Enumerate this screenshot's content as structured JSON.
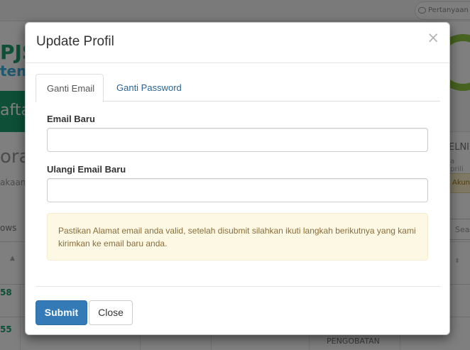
{
  "background": {
    "question_label": "Pertanyaan",
    "logo_text": "PJS",
    "logo_sub": "ten",
    "green_nav_text": "afta",
    "heading_partial": "ora",
    "sub_partial": "akaan",
    "right_text": "ELNI",
    "right_sub": "a prili",
    "badge_partial": "Akun",
    "rows_label": "ows",
    "search_partial": "Sea",
    "row_num_1": "58",
    "row_num_2": "55",
    "cell_text": "PENGOBATAN"
  },
  "modal": {
    "title": "Update Profil",
    "close_symbol": "×",
    "tabs": [
      {
        "label": "Ganti Email",
        "active": true
      },
      {
        "label": "Ganti Password",
        "active": false
      }
    ],
    "fields": {
      "email_baru": {
        "label": "Email Baru",
        "value": ""
      },
      "ulangi_email": {
        "label": "Ulangi Email Baru",
        "value": ""
      }
    },
    "alert_text": "Pastikan Alamat email anda valid, setelah disubmit silahkan ikuti langkah berikutnya yang kami kirimkan ke email baru anda.",
    "buttons": {
      "submit": "Submit",
      "close": "Close"
    }
  },
  "colors": {
    "primary": "#337ab7",
    "alert_bg": "#fcf8e3",
    "alert_text": "#8a6d3b",
    "tab_link": "#2a6496",
    "brand_green": "#1a9f6e"
  }
}
